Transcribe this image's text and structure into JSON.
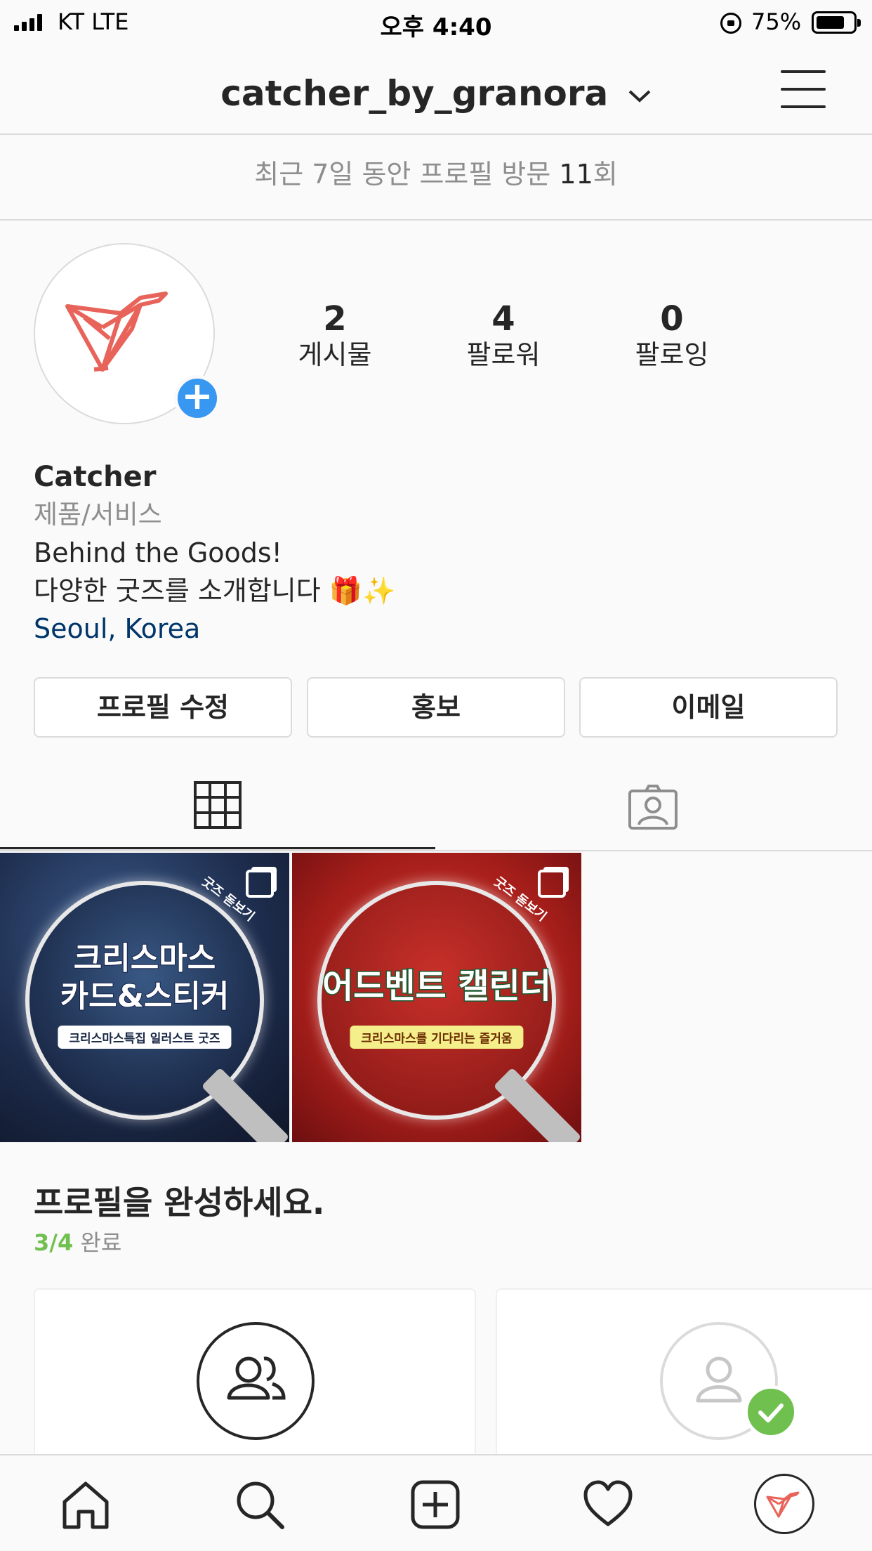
{
  "status_bar": {
    "carrier": "KT  LTE",
    "time": "오후 4:40",
    "battery_percent_label": "75%",
    "battery_level": 0.75
  },
  "header": {
    "username": "catcher_by_granora",
    "dropdown_icon": "chevron-down-icon",
    "menu_icon": "hamburger-menu-icon"
  },
  "visits": {
    "prefix": "최근 7일 동안 프로필 방문 ",
    "count": "11",
    "suffix": "회"
  },
  "profile": {
    "stats": [
      {
        "value": "2",
        "label": "게시물"
      },
      {
        "value": "4",
        "label": "팔로워"
      },
      {
        "value": "0",
        "label": "팔로잉"
      }
    ],
    "name": "Catcher",
    "category": "제품/서비스",
    "bio_line1": "Behind the Goods!",
    "bio_line2": "다양한 굿즈를 소개합니다 🎁✨",
    "location": "Seoul, Korea",
    "brand_color": "#e8645a"
  },
  "buttons": {
    "edit_profile": "프로필 수정",
    "promote": "홍보",
    "email": "이메일"
  },
  "tabs": [
    {
      "icon": "grid-icon",
      "active": true
    },
    {
      "icon": "tagged-icon",
      "active": false
    }
  ],
  "posts": [
    {
      "corner_text": "굿즈 돋보기",
      "title_line1": "크리스마스",
      "title_line2": "카드&스티커",
      "badge": "크리스마스특집 일러스트 굿즈",
      "multi_icon": "multiple-images-icon"
    },
    {
      "corner_text": "굿즈 돋보기",
      "title_line1": "어드벤트 캘린더",
      "title_line2": "",
      "badge": "크리스마스를 기다리는 즐거움",
      "multi_icon": "multiple-images-icon"
    }
  ],
  "complete_profile": {
    "title": "프로필을 완성하세요.",
    "progress": "3/4",
    "progress_suffix": " 완료",
    "cards": [
      {
        "icon": "people-icon"
      },
      {
        "icon": "profile-photo-icon",
        "done": true
      }
    ]
  },
  "bottom_nav": [
    {
      "icon": "home-icon"
    },
    {
      "icon": "search-icon"
    },
    {
      "icon": "add-post-icon"
    },
    {
      "icon": "heart-icon"
    },
    {
      "icon": "profile-avatar-icon"
    }
  ],
  "colors": {
    "accent_blue": "#3897f0",
    "success_green": "#70c050",
    "location_link": "#003569"
  }
}
